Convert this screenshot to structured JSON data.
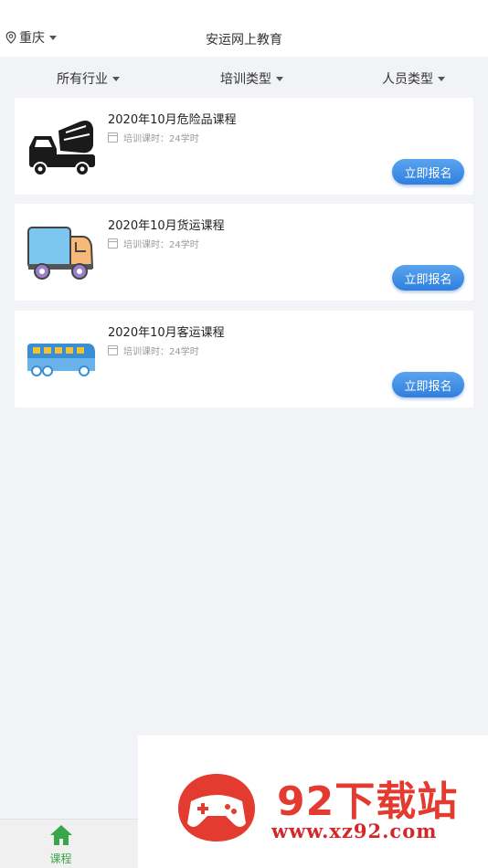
{
  "header": {
    "city": "重庆",
    "title": "安运网上教育"
  },
  "filters": [
    {
      "label": "所有行业"
    },
    {
      "label": "培训类型"
    },
    {
      "label": "人员类型"
    }
  ],
  "courses": [
    {
      "title": "2020年10月危险品课程",
      "meta": "培训课时：24学时",
      "button": "立即报名",
      "icon": "mixer-truck-icon"
    },
    {
      "title": "2020年10月货运课程",
      "meta": "培训课时：24学时",
      "button": "立即报名",
      "icon": "delivery-truck-icon"
    },
    {
      "title": "2020年10月客运课程",
      "meta": "培训课时：24学时",
      "button": "立即报名",
      "icon": "bus-icon"
    }
  ],
  "tabbar": {
    "course_label": "课程"
  },
  "ad": {
    "brand": "92下载站",
    "url": "www.xz92.com"
  },
  "colors": {
    "accent_button": "#3b8ae6",
    "tab_active": "#3aa64a",
    "ad_red": "#e33b2f"
  }
}
